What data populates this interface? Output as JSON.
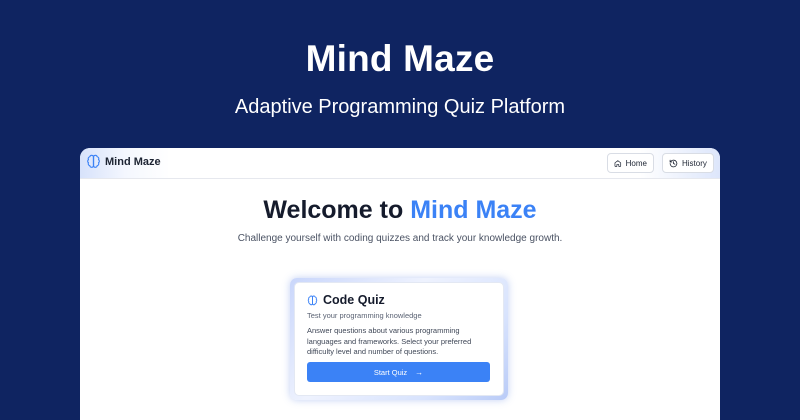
{
  "hero": {
    "title": "Mind Maze",
    "subtitle": "Adaptive Programming Quiz Platform"
  },
  "navbar": {
    "brand": "Mind Maze",
    "home_label": "Home",
    "history_label": "History"
  },
  "welcome": {
    "heading_prefix": "Welcome to ",
    "heading_accent": "Mind Maze",
    "tagline": "Challenge yourself with coding quizzes and track your knowledge growth."
  },
  "card": {
    "title": "Code Quiz",
    "subtitle": "Test your programming knowledge",
    "description": "Answer questions about various programming languages and frameworks. Select your preferred difficulty level and number of questions.",
    "button_label": "Start Quiz",
    "button_arrow": "→"
  },
  "colors": {
    "background": "#0f2461",
    "accent": "#3b82f6"
  },
  "icons": {
    "brand": "brain-icon",
    "home": "home-icon",
    "history": "history-icon",
    "card": "brain-icon",
    "button": "arrow-right-icon"
  }
}
